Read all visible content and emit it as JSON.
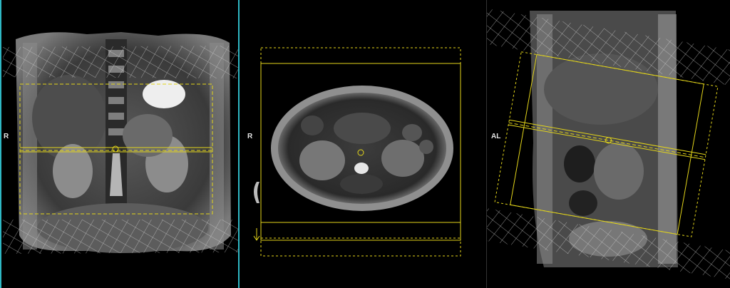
{
  "viewports": {
    "coronal": {
      "orientation_label": "R"
    },
    "axial": {
      "orientation_label": "R"
    },
    "sagittal": {
      "orientation_label": "AL"
    }
  },
  "colors": {
    "planning_box": "#e3d51a",
    "saturation_band": "#d0d0d0",
    "active_border": "#2fb8c4",
    "orientation_text": "#e6e6e6"
  }
}
